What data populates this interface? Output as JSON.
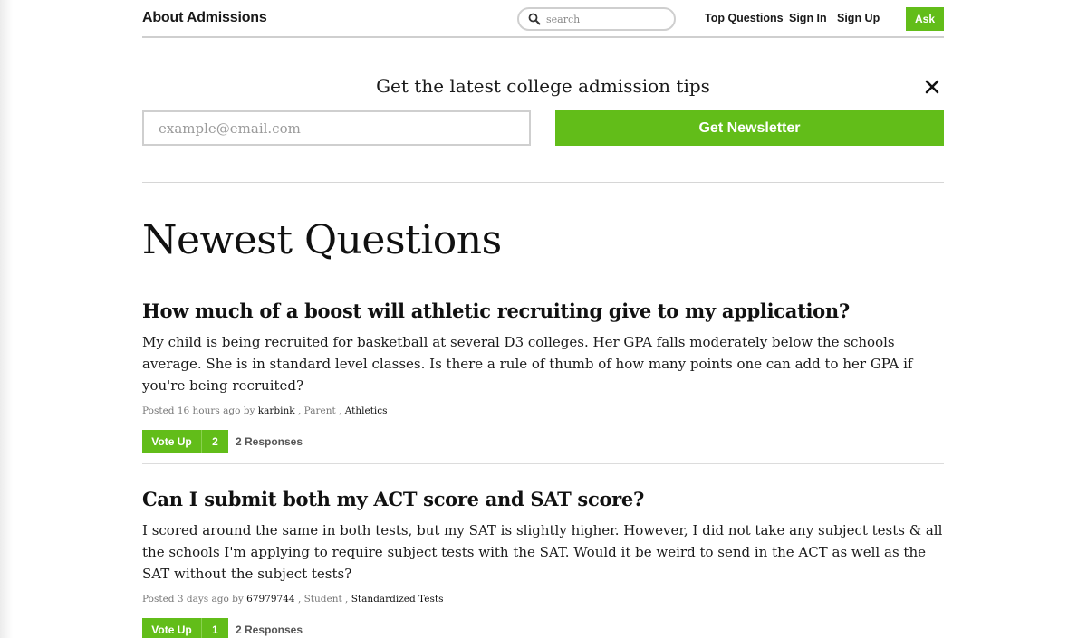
{
  "header": {
    "brand": "About Admissions",
    "search_placeholder": "search",
    "nav": [
      "Top Questions",
      "Sign In",
      "Sign Up"
    ],
    "ask_label": "Ask"
  },
  "newsletter": {
    "title": "Get the latest college admission tips",
    "email_placeholder": "example@email.com",
    "button_label": "Get Newsletter"
  },
  "section_title": "Newest Questions",
  "questions": [
    {
      "title": "How much of a boost will athletic recruiting give to my application?",
      "body": "My child is being recruited for basketball at several D3 colleges. Her GPA falls moderately below the schools average. She is in standard level classes. Is there a rule of thumb of how many points one can add to her GPA if you're being recruited?",
      "posted": "Posted 16 hours ago by",
      "author": "karbink",
      "role": ", Parent ,",
      "category": "Athletics",
      "vote_label": "Vote Up",
      "votes": "2",
      "responses": "2 Responses"
    },
    {
      "title": "Can I submit both my ACT score and SAT score?",
      "body": "I scored around the same in both tests, but my SAT is slightly higher. However, I did not take any subject tests & all the schools I'm applying to require subject tests with the SAT. Would it be weird to send in the ACT as well as the SAT without the subject tests?",
      "posted": "Posted 3 days ago by",
      "author": "67979744",
      "role": ", Student ,",
      "category": "Standardized Tests",
      "vote_label": "Vote Up",
      "votes": "1",
      "responses": "2 Responses"
    }
  ],
  "colors": {
    "accent": "#62bd19",
    "border": "#cfcfcf"
  }
}
